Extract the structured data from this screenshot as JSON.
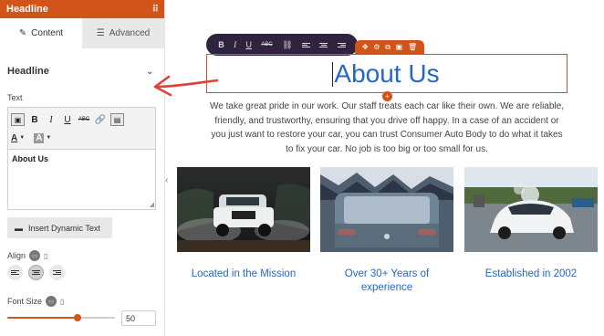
{
  "panel": {
    "title": "Headline",
    "tabs": [
      {
        "label": "Content",
        "icon": "pencil-icon",
        "active": true
      },
      {
        "label": "Advanced",
        "icon": "sliders-icon",
        "active": false
      }
    ],
    "section_title": "Headline",
    "text_label": "Text",
    "editor": {
      "toolbar_row1": [
        "B",
        "I",
        "U",
        "ABC"
      ],
      "toolbar_row2": [
        "A",
        "A"
      ],
      "content": "About Us"
    },
    "dynamic_button": "Insert Dynamic Text",
    "align_label": "Align",
    "align_selected": "center",
    "font_size_label": "Font Size",
    "font_size_value": "50",
    "font_size_slider_fraction": 0.65
  },
  "toolbar": {
    "buttons": [
      "B",
      "I",
      "U",
      "ABC"
    ]
  },
  "canvas": {
    "headline": "About Us",
    "intro": "We take great pride in our work. Our staff treats each car like their own. We are reliable, friendly, and trustworthy, ensuring that you drive off happy. In a case of an accident or you just want to restore your car, you can trust Consumer Auto Body to do what it takes to fix your car. No job is too big or too small for us.",
    "cards": [
      {
        "title": "Located in the Mission",
        "image": "white-suv-offroad-photo"
      },
      {
        "title": "Over 30+ Years of experience",
        "image": "frosted-car-photo"
      },
      {
        "title": "Established in 2002",
        "image": "white-sports-car-wash-photo"
      }
    ]
  },
  "colors": {
    "accent": "#d2541b",
    "heading_blue": "#2567c8",
    "toolbar_dark": "#2f2440",
    "annotation_red": "#e0413a"
  }
}
